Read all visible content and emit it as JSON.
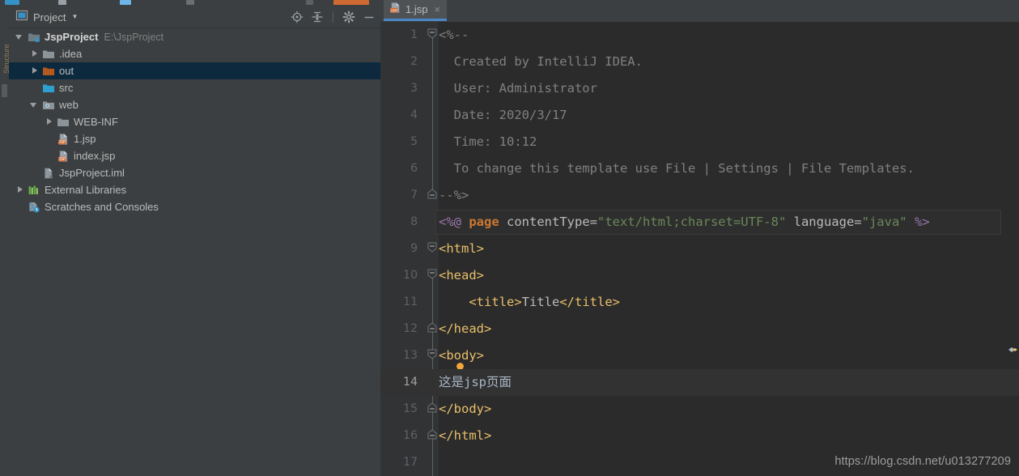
{
  "colors": {
    "panel_bg": "#3c3f41",
    "editor_bg": "#2b2b2b",
    "gutter_bg": "#313335",
    "selection_bg": "#0d293e",
    "tab_accent": "#4a88c7",
    "comment": "#808080",
    "tag": "#e8bf6a",
    "string": "#6a8759",
    "keyword": "#cc7832",
    "directive": "#9876aa",
    "text": "#a9b7c6"
  },
  "project_panel": {
    "title": "Project",
    "caret_icon": "chevron-down-icon",
    "actions": [
      {
        "name": "select-opened-file-icon",
        "label": "Select Opened File"
      },
      {
        "name": "collapse-all-icon",
        "label": "Collapse All"
      },
      {
        "name": "gear-icon",
        "label": "Settings"
      },
      {
        "name": "minimize-icon",
        "label": "Hide"
      }
    ],
    "tree": [
      {
        "label": "JspProject",
        "path": "E:\\JspProject",
        "icon": "module-folder-icon",
        "arrow": "down",
        "indent": 0,
        "bold": true,
        "selected": false
      },
      {
        "label": ".idea",
        "path": "",
        "icon": "folder-icon",
        "arrow": "right",
        "indent": 1,
        "bold": false,
        "selected": false
      },
      {
        "label": "out",
        "path": "",
        "icon": "excluded-folder-icon",
        "arrow": "right",
        "indent": 1,
        "bold": false,
        "selected": true
      },
      {
        "label": "src",
        "path": "",
        "icon": "source-folder-icon",
        "arrow": "none",
        "indent": 1,
        "bold": false,
        "selected": false
      },
      {
        "label": "web",
        "path": "",
        "icon": "web-folder-icon",
        "arrow": "down",
        "indent": 1,
        "bold": false,
        "selected": false
      },
      {
        "label": "WEB-INF",
        "path": "",
        "icon": "folder-icon",
        "arrow": "right",
        "indent": 2,
        "bold": false,
        "selected": false
      },
      {
        "label": "1.jsp",
        "path": "",
        "icon": "jsp-file-icon",
        "arrow": "none",
        "indent": 2,
        "bold": false,
        "selected": false
      },
      {
        "label": "index.jsp",
        "path": "",
        "icon": "jsp-file-icon",
        "arrow": "none",
        "indent": 2,
        "bold": false,
        "selected": false
      },
      {
        "label": "JspProject.iml",
        "path": "",
        "icon": "iml-file-icon",
        "arrow": "none",
        "indent": 1,
        "bold": false,
        "selected": false
      },
      {
        "label": "External Libraries",
        "path": "",
        "icon": "libraries-icon",
        "arrow": "right",
        "indent": 0,
        "bold": false,
        "selected": false
      },
      {
        "label": "Scratches and Consoles",
        "path": "",
        "icon": "scratches-icon",
        "arrow": "none",
        "indent": 0,
        "bold": false,
        "selected": false
      }
    ]
  },
  "editor": {
    "tabs": [
      {
        "label": "1.jsp",
        "icon": "jsp-file-icon",
        "close_label": "×",
        "active": true
      }
    ],
    "current_line": 14,
    "lines": [
      {
        "num": "1",
        "fold": "start",
        "text": "<%--"
      },
      {
        "num": "2",
        "fold": "none",
        "text": "  Created by IntelliJ IDEA."
      },
      {
        "num": "3",
        "fold": "none",
        "text": "  User: Administrator"
      },
      {
        "num": "4",
        "fold": "none",
        "text": "  Date: 2020/3/17"
      },
      {
        "num": "5",
        "fold": "none",
        "text": "  Time: 10:12"
      },
      {
        "num": "6",
        "fold": "none",
        "text": "  To change this template use File | Settings | File Templates."
      },
      {
        "num": "7",
        "fold": "end",
        "text": "--%>"
      },
      {
        "num": "8",
        "fold": "none",
        "text": "<%@ page contentType=\"text/html;charset=UTF-8\" language=\"java\" %>"
      },
      {
        "num": "9",
        "fold": "start",
        "text": "<html>"
      },
      {
        "num": "10",
        "fold": "start",
        "text": "<head>"
      },
      {
        "num": "11",
        "fold": "none",
        "text": "    <title>Title</title>"
      },
      {
        "num": "12",
        "fold": "end",
        "text": "</head>"
      },
      {
        "num": "13",
        "fold": "start",
        "text": "<body>"
      },
      {
        "num": "14",
        "fold": "none",
        "text": "这是jsp页面"
      },
      {
        "num": "15",
        "fold": "end",
        "text": "</body>"
      },
      {
        "num": "16",
        "fold": "end",
        "text": "</html>"
      },
      {
        "num": "17",
        "fold": "none",
        "text": ""
      }
    ],
    "line_8_tokens": [
      {
        "t": "<%@",
        "c": "c-dir"
      },
      {
        "t": " ",
        "c": "c-plain"
      },
      {
        "t": "page",
        "c": "c-kw"
      },
      {
        "t": " contentType=",
        "c": "c-attr"
      },
      {
        "t": "\"text/html;charset=UTF-8\"",
        "c": "c-str"
      },
      {
        "t": " language=",
        "c": "c-attr"
      },
      {
        "t": "\"java\"",
        "c": "c-str"
      },
      {
        "t": " %>",
        "c": "c-dir"
      }
    ],
    "intention_bulb": {
      "name": "intention-bulb-icon",
      "line": 13
    }
  },
  "watermark": "https://blog.csdn.net/u013277209",
  "left_stripe": {
    "label": "Structure"
  }
}
